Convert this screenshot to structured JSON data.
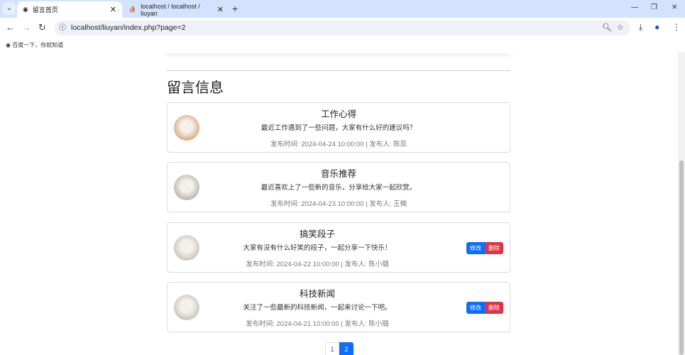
{
  "browser": {
    "tabs": [
      {
        "title": "留言首页",
        "active": true
      },
      {
        "title": "localhost / localhost / liuyan",
        "active": false
      }
    ],
    "url": "localhost/liuyan/index.php?page=2",
    "bookmark": "百度一下，你就知道"
  },
  "page": {
    "heading": "留言信息",
    "messages": [
      {
        "title": "工作心得",
        "body": "最近工作遇到了一些问题，大家有什么好的建议吗？",
        "meta": "发布时间: 2024-04-24 10:00:00 | 发布人: 陈蕊",
        "avatar_color": "#d9a877",
        "editable": false
      },
      {
        "title": "音乐推荐",
        "body": "最近喜欢上了一些新的音乐，分享给大家一起欣赏。",
        "meta": "发布时间: 2024-04-23 10:00:00 | 发布人: 王楠",
        "avatar_color": "#b8b2a8",
        "editable": false
      },
      {
        "title": "搞笑段子",
        "body": "大家有没有什么好笑的段子，一起分享一下快乐！",
        "meta": "发布时间: 2024-04-22 10:00:00 | 发布人: 陈小璐",
        "avatar_color": "#c9c3b8",
        "editable": true
      },
      {
        "title": "科技新闻",
        "body": "关注了一些最新的科技新闻，一起来讨论一下吧。",
        "meta": "发布时间: 2024-04-21 10:00:00 | 发布人: 陈小璐",
        "avatar_color": "#c9c3b8",
        "editable": true
      }
    ],
    "edit_label": "修改",
    "delete_label": "删除",
    "pagination": [
      "1",
      "2"
    ],
    "current_page": "2"
  }
}
